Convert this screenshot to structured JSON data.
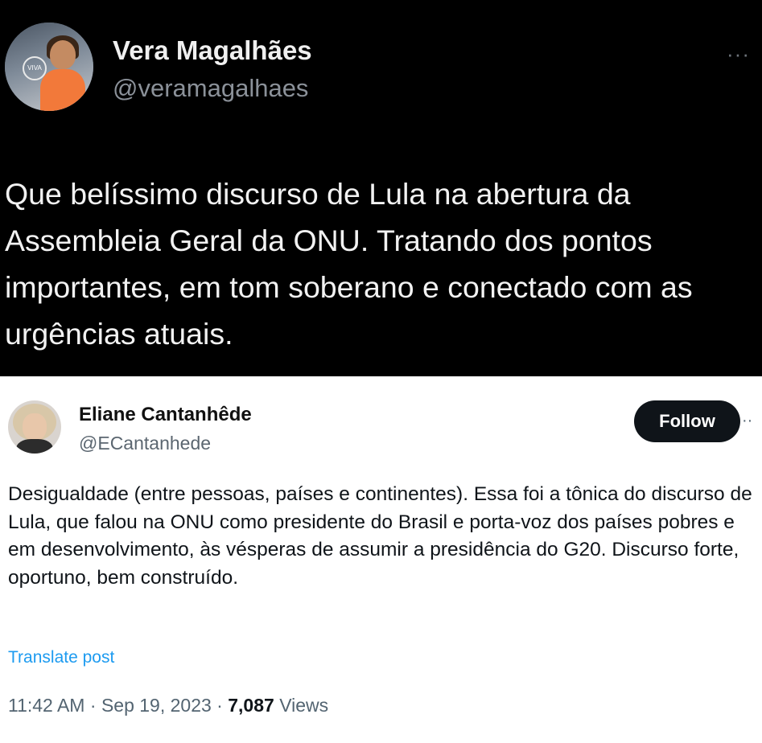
{
  "post": {
    "author": {
      "name": "Vera Magalhães",
      "handle": "@veramagalhaes",
      "avatar_logo_text": "VIVA"
    },
    "more_label": "···",
    "text": "Que belíssimo discurso de Lula na abertura da Assembleia Geral da ONU. Tratando dos pontos importantes, em tom soberano e conectado com as urgências atuais."
  },
  "quoted": {
    "author": {
      "name": "Eliane Cantanhêde",
      "handle": "@ECantanhede"
    },
    "follow_label": "Follow",
    "more_label": "··",
    "text": "Desigualdade (entre pessoas, países e continentes). Essa foi a tônica do discurso de Lula, que falou na ONU como presidente do Brasil e porta-voz dos países pobres e em desenvolvimento, às vésperas de assumir a presidência do G20. Discurso forte, oportuno, bem construído.",
    "translate_label": "Translate post",
    "time": "11:42 AM",
    "date": "Sep 19, 2023",
    "views_count": "7,087",
    "views_label": "Views"
  },
  "colors": {
    "link": "#1d9bf0",
    "follow_bg": "#0f1419"
  }
}
